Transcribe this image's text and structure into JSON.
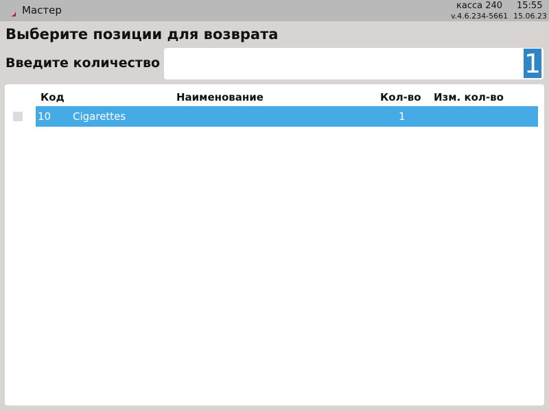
{
  "header": {
    "app_title": "Мастер",
    "register": "касса 240",
    "time": "15:55",
    "version": "v.4.6.234-5661",
    "date": "15.06.23"
  },
  "page": {
    "title": "Выберите позиции для возврата",
    "quantity_label": "Введите количество",
    "quantity_value": "1"
  },
  "table": {
    "columns": {
      "code": "Код",
      "name": "Наименование",
      "qty": "Кол-во",
      "changed_qty": "Изм. кол-во"
    },
    "rows": [
      {
        "code": "10",
        "name": "Cigarettes",
        "qty": "1",
        "changed_qty": "",
        "selected": true,
        "checked": false
      }
    ]
  },
  "colors": {
    "accent": "#2f86c6",
    "selected_row": "#45aae6",
    "logo": "#c8102e"
  },
  "icons": {
    "logo": "app-logo-icon"
  }
}
